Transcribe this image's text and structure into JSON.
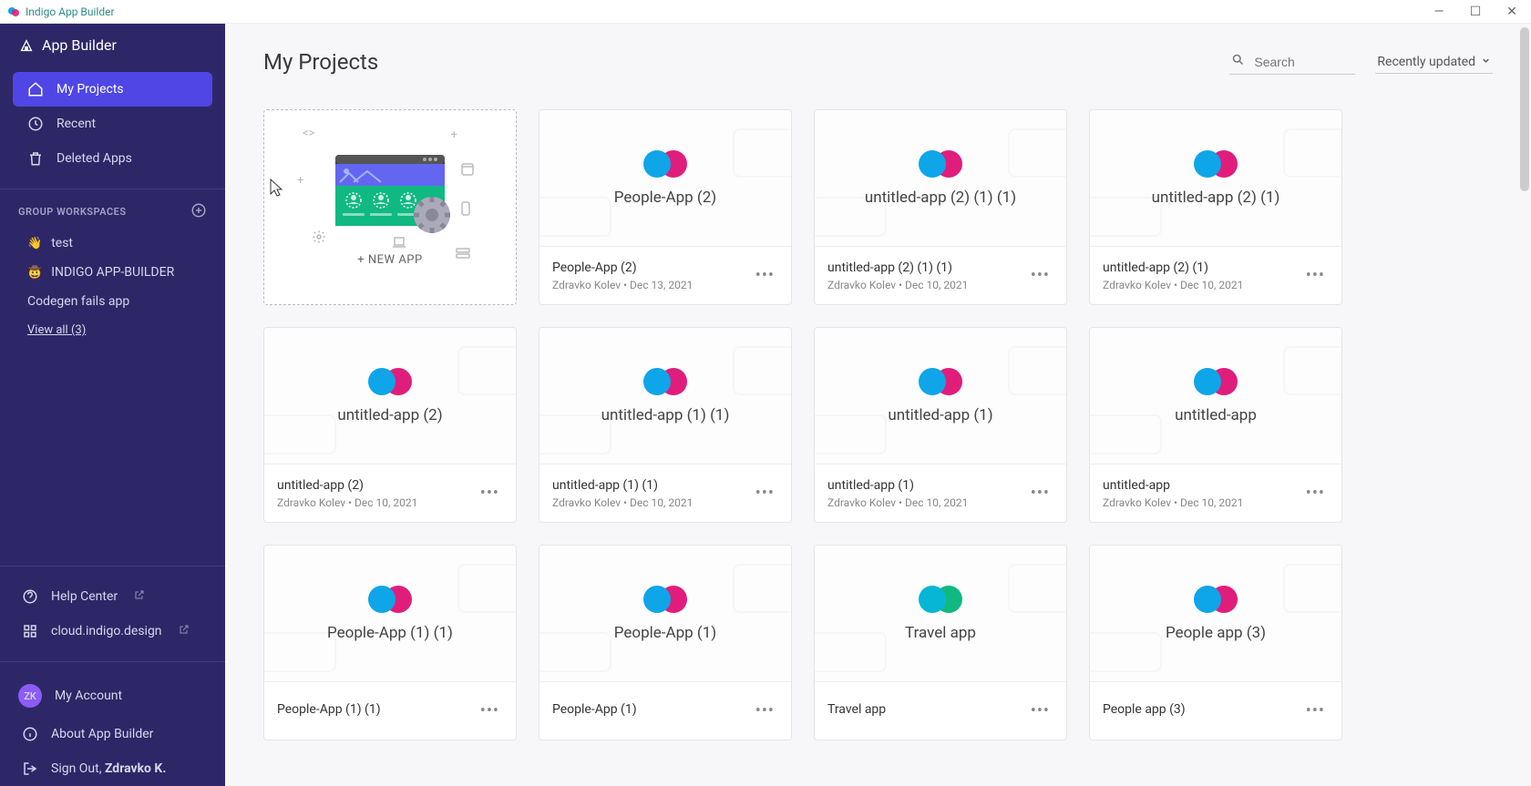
{
  "window": {
    "title": "Indigo App Builder"
  },
  "brand": {
    "name": "App Builder"
  },
  "nav": {
    "my_projects": "My Projects",
    "recent": "Recent",
    "deleted": "Deleted Apps"
  },
  "workspaces": {
    "header": "GROUP WORKSPACES",
    "items": [
      {
        "emoji": "👋",
        "name": "test"
      },
      {
        "emoji": "🤠",
        "name": "INDIGO APP-BUILDER"
      },
      {
        "emoji": "",
        "name": "Codegen fails app"
      }
    ],
    "view_all": "View all (3)"
  },
  "bottom": {
    "help": "Help Center",
    "cloud": "cloud.indigo.design",
    "account": "My Account",
    "avatar": "ZK",
    "about": "About App Builder",
    "signout_prefix": "Sign Out, ",
    "signout_name": "Zdravko K."
  },
  "page": {
    "title": "My Projects",
    "search_placeholder": "Search",
    "sort": "Recently updated"
  },
  "new_app": "+ NEW APP",
  "more_glyph": "•••",
  "projects": [
    {
      "preview": "People-App (2)",
      "title": "People-App (2)",
      "author": "Zdravko Kolev",
      "date": "Dec 13, 2021",
      "variant": "default"
    },
    {
      "preview": "untitled-app (2) (1) (1)",
      "title": "untitled-app (2) (1) (1)",
      "author": "Zdravko Kolev",
      "date": "Dec 10, 2021",
      "variant": "default"
    },
    {
      "preview": "untitled-app (2) (1)",
      "title": "untitled-app (2) (1)",
      "author": "Zdravko Kolev",
      "date": "Dec 10, 2021",
      "variant": "default"
    },
    {
      "preview": "untitled-app (2)",
      "title": "untitled-app (2)",
      "author": "Zdravko Kolev",
      "date": "Dec 10, 2021",
      "variant": "default"
    },
    {
      "preview": "untitled-app (1) (1)",
      "title": "untitled-app (1) (1)",
      "author": "Zdravko Kolev",
      "date": "Dec 10, 2021",
      "variant": "default"
    },
    {
      "preview": "untitled-app (1)",
      "title": "untitled-app (1)",
      "author": "Zdravko Kolev",
      "date": "Dec 10, 2021",
      "variant": "default"
    },
    {
      "preview": "untitled-app",
      "title": "untitled-app",
      "author": "Zdravko Kolev",
      "date": "Dec 10, 2021",
      "variant": "default"
    },
    {
      "preview": "People-App (1) (1)",
      "title": "People-App (1) (1)",
      "author": "",
      "date": "",
      "variant": "default"
    },
    {
      "preview": "People-App (1)",
      "title": "People-App (1)",
      "author": "",
      "date": "",
      "variant": "default"
    },
    {
      "preview": "Travel app",
      "title": "Travel app",
      "author": "",
      "date": "",
      "variant": "teal"
    },
    {
      "preview": "People app (3)",
      "title": "People app (3)",
      "author": "",
      "date": "",
      "variant": "default"
    }
  ]
}
